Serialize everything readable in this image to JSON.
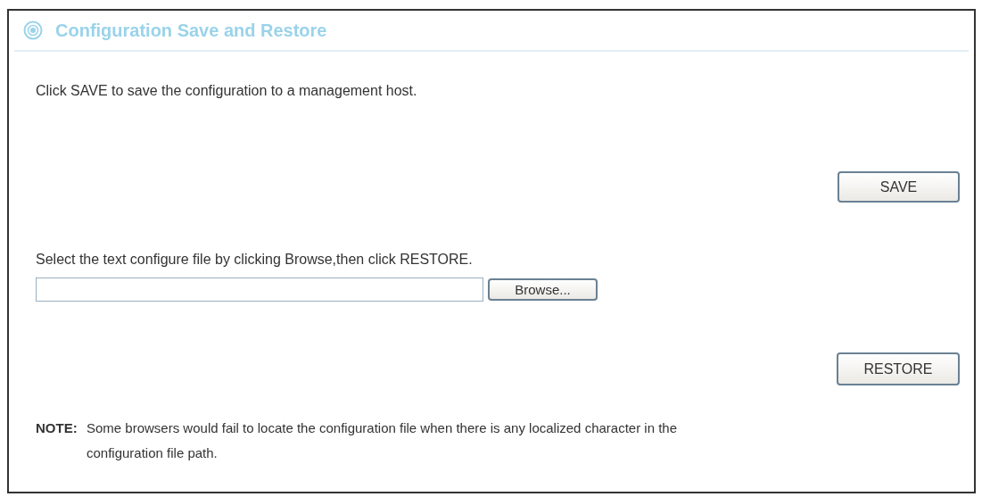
{
  "panel": {
    "title": "Configuration Save and Restore"
  },
  "save_section": {
    "instruction": "Click SAVE to save the configuration to a management host.",
    "button": "SAVE"
  },
  "restore_section": {
    "instruction": "Select the text configure file by clicking Browse,then click RESTORE.",
    "browse_button": "Browse...",
    "button": "RESTORE"
  },
  "note": {
    "label": "NOTE:",
    "text": "Some browsers would fail to locate the configuration file when there is any localized character in the configuration file path."
  }
}
